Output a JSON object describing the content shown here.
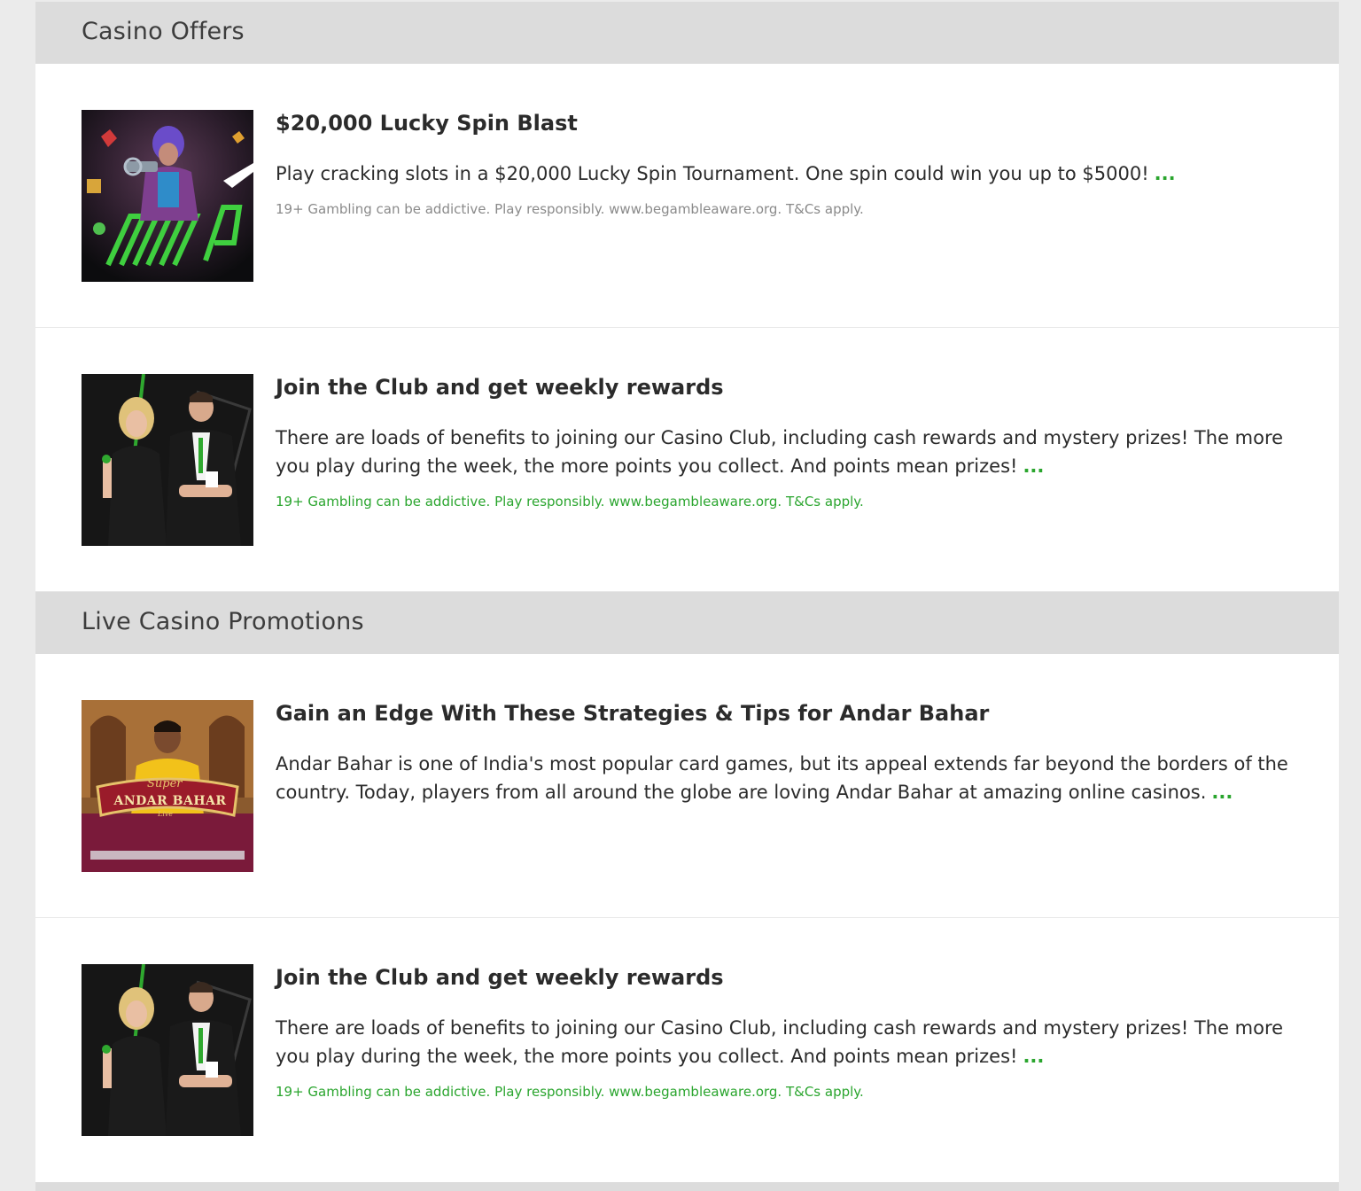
{
  "sections": [
    {
      "title": "Casino Offers",
      "offers": [
        {
          "title": "$20,000 Lucky Spin Blast",
          "description": "Play cracking slots in a $20,000 Lucky Spin Tournament. One spin could win you up to $5000!",
          "more": "...",
          "terms": "19+ Gambling can be addictive. Play responsibly. www.begambleaware.org. T&Cs apply.",
          "image": "lucky-spin-heroine-image"
        },
        {
          "title": "Join the Club and get weekly rewards",
          "description": "There are loads of benefits to joining our Casino Club, including cash rewards and mystery prizes! The more you play during the week, the more points you collect. And points mean prizes!",
          "more": "...",
          "terms": "19+ Gambling can be addictive. Play responsibly. www.begambleaware.org. T&Cs apply.",
          "image": "casino-club-dealers-image"
        }
      ]
    },
    {
      "title": "Live Casino Promotions",
      "offers": [
        {
          "title": "Gain an Edge With These Strategies & Tips for Andar Bahar",
          "description": "Andar Bahar is one of India's most popular card games, but its appeal extends far beyond the borders of the country. Today, players from all around the globe are loving Andar Bahar at amazing online casinos.",
          "more": "...",
          "image": "andar-bahar-image",
          "image_text": {
            "line1": "Super",
            "line2": "ANDAR BAHAR",
            "line3": "Live"
          }
        },
        {
          "title": "Join the Club and get weekly rewards",
          "description": "There are loads of benefits to joining our Casino Club, including cash rewards and mystery prizes! The more you play during the week, the more points you collect. And points mean prizes!",
          "more": "...",
          "terms": "19+ Gambling can be addictive. Play responsibly. www.begambleaware.org. T&Cs apply.",
          "image": "casino-club-dealers-image"
        }
      ]
    }
  ],
  "colors": {
    "accent_green": "#2aa52e",
    "header_bg": "#dcdcdc",
    "page_bg": "#ebebeb",
    "card_bg": "#ffffff",
    "text_dark": "#2b2b2b",
    "text_muted": "#8a8a8a"
  }
}
